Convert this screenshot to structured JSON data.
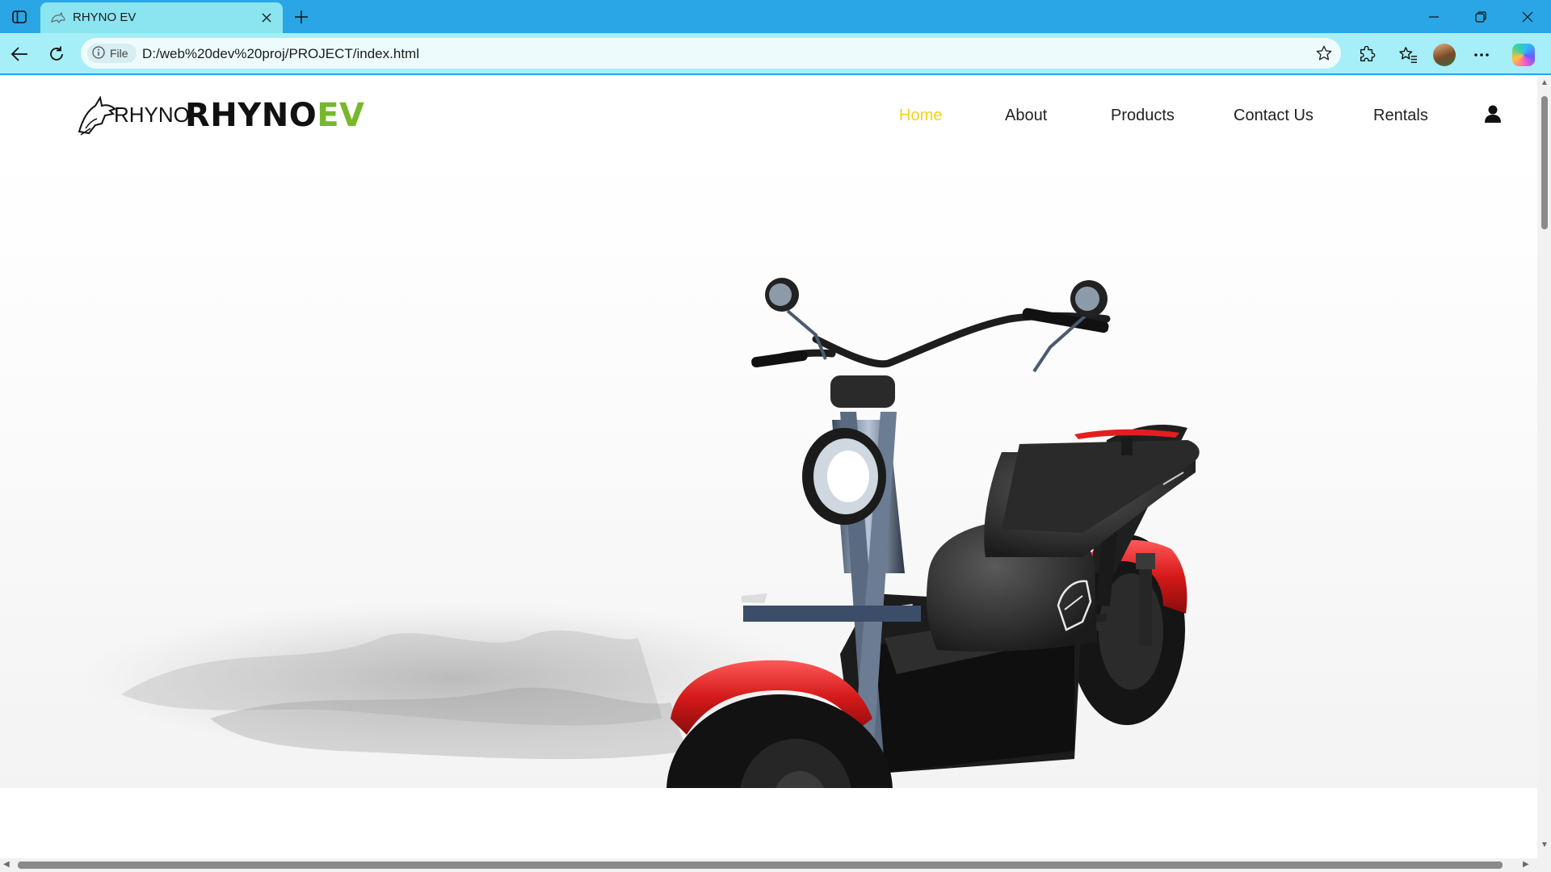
{
  "browser": {
    "tab_title": "RHYNO EV",
    "site_info_label": "File",
    "url": "D:/web%20dev%20proj/PROJECT/index.html",
    "colors": {
      "tabbar": "#2aa6e6",
      "active_tab": "#8ae5f1",
      "toolbar": "#a6eef8"
    },
    "icons": {
      "tab_panel": "tab-panel-icon",
      "favicon": "rhino-favicon-icon",
      "close": "close-icon",
      "new_tab": "plus-icon",
      "back": "arrow-left-icon",
      "reload": "reload-icon",
      "info": "info-icon",
      "favorite": "star-icon",
      "extensions": "puzzle-icon",
      "favorites": "favorites-icon",
      "more": "more-icon",
      "copilot": "copilot-icon"
    }
  },
  "site": {
    "logo_small": "RHYNO",
    "logo_main": "RHYNO",
    "logo_accent": "EV",
    "nav": [
      {
        "label": "Home",
        "active": true
      },
      {
        "label": "About",
        "active": false
      },
      {
        "label": "Products",
        "active": false
      },
      {
        "label": "Contact Us",
        "active": false
      },
      {
        "label": "Rentals",
        "active": false
      }
    ],
    "colors": {
      "nav_active": "#f2d21c",
      "logo_accent": "#76b82a"
    },
    "hero": {
      "image_subject": "red electric scooter"
    }
  }
}
